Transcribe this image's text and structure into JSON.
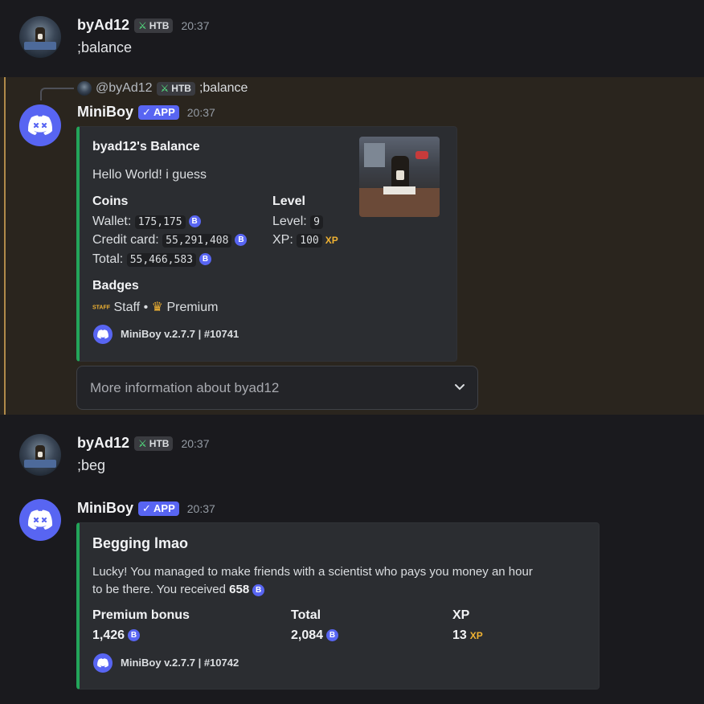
{
  "messages": [
    {
      "author": "byAd12",
      "tag": "HTB",
      "time": "20:37",
      "content": ";balance"
    },
    {
      "reply": {
        "author": "@byAd12",
        "tag": "HTB",
        "content": ";balance"
      },
      "author": "MiniBoy",
      "app_badge": "✓ APP",
      "time": "20:37",
      "embed": {
        "title": "byad12's Balance",
        "description": "Hello World! i guess",
        "fields": {
          "coins": {
            "name": "Coins",
            "wallet_label": "Wallet:",
            "wallet": "175,175",
            "credit_label": "Credit card:",
            "credit": "55,291,408",
            "total_label": "Total:",
            "total": "55,466,583"
          },
          "level": {
            "name": "Level",
            "level_label": "Level:",
            "level": "9",
            "xp_label": "XP:",
            "xp": "100",
            "xp_icon": "XP"
          },
          "badges": {
            "name": "Badges",
            "staff_icon": "STAFF",
            "staff": "Staff",
            "sep": "•",
            "premium": "Premium"
          }
        },
        "footer": "MiniBoy v.2.7.7 | #10741"
      },
      "select_menu": {
        "placeholder": "More information about byad12"
      }
    },
    {
      "author": "byAd12",
      "tag": "HTB",
      "time": "20:37",
      "content": ";beg"
    },
    {
      "author": "MiniBoy",
      "app_badge": "✓ APP",
      "time": "20:37",
      "embed": {
        "title": "Begging lmao",
        "description_1": "Lucky! You managed to make friends with a scientist who pays you money an hour",
        "description_2_prefix": "to be there. You received ",
        "description_2_amount": "658",
        "fields": {
          "premium": {
            "name": "Premium bonus",
            "value": "1,426"
          },
          "total": {
            "name": "Total",
            "value": "2,084"
          },
          "xp": {
            "name": "XP",
            "value": "13",
            "icon": "XP"
          }
        },
        "footer": "MiniBoy v.2.7.7 | #10742"
      }
    }
  ],
  "colors": {
    "background": "#1a1a1e",
    "highlight": "#2a251e",
    "highlight_bar": "#b08a4a",
    "embed_bg": "#2b2d31",
    "embed_accent": "#23a55a",
    "blurple": "#5865f2",
    "xp_gold": "#f0b232"
  },
  "icons": {
    "bot_avatar": "discord-logo-icon",
    "coin": "b-coin-icon",
    "sword": "sword-icon",
    "crown": "crown-icon",
    "chevron": "chevron-down-icon"
  }
}
